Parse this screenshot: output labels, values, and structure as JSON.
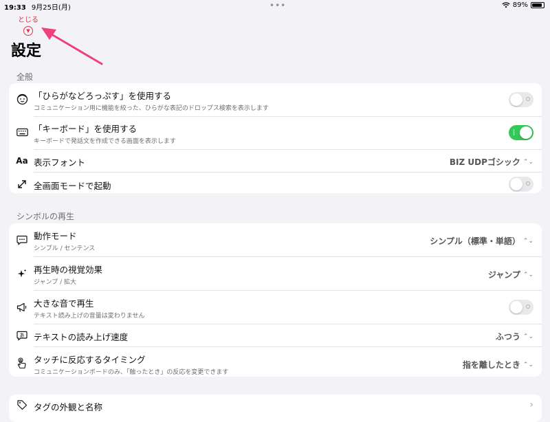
{
  "status_bar": {
    "time": "19:33",
    "date": "9月25日(月)",
    "battery": "89%",
    "battery_level": 0.89
  },
  "close_button": {
    "label": "とじる"
  },
  "title": "設定",
  "sections": {
    "general": {
      "header": "全般",
      "hiragana": {
        "label": "「ひらがなどろっぷす」を使用する",
        "sub": "コミュニケーション用に機能を絞った、ひらがな表記のドロップス検索を表示します",
        "on": false
      },
      "keyboard": {
        "label": "「キーボード」を使用する",
        "sub": "キーボードで発話文を作成できる画面を表示します",
        "on": true
      },
      "font": {
        "label": "表示フォント",
        "value": "BIZ UDPゴシック",
        "icon_text": "Aa"
      },
      "fullscreen": {
        "label": "全画面モードで起動",
        "on": false
      }
    },
    "playback": {
      "header": "シンボルの再生",
      "mode": {
        "label": "動作モード",
        "sub": "シンプル / センテンス",
        "value": "シンプル（標準・単語）"
      },
      "effect": {
        "label": "再生時の視覚効果",
        "sub": "ジャンプ / 拡大",
        "value": "ジャンプ"
      },
      "loud": {
        "label": "大きな音で再生",
        "sub": "テキスト読み上げの音量は変わりません",
        "on": false
      },
      "speed": {
        "label": "テキストの読み上げ速度",
        "value": "ふつう"
      },
      "timing": {
        "label": "タッチに反応するタイミング",
        "sub": "コミュニケーションボードのみ、「触ったとき」の反応を変更できます",
        "value": "指を離したとき"
      }
    },
    "tags": {
      "label": "タグの外観と名称"
    }
  },
  "colors": {
    "accent_red": "#e0304a",
    "toggle_on": "#34c759",
    "arrow": "#f0407a"
  },
  "icons": {
    "wifi": "wifi-icon",
    "battery": "battery-icon",
    "close": "chevron-down-circle-icon",
    "hiragana": "face-icon",
    "keyboard": "keyboard-icon",
    "fullscreen": "expand-arrows-icon",
    "mode": "speech-bubble-icon",
    "effect": "sparkles-icon",
    "loud": "megaphone-icon",
    "speed": "speech-a-icon",
    "timing": "hand-tap-icon",
    "tags": "tag-icon",
    "disclosure": "chevron-right-icon"
  }
}
